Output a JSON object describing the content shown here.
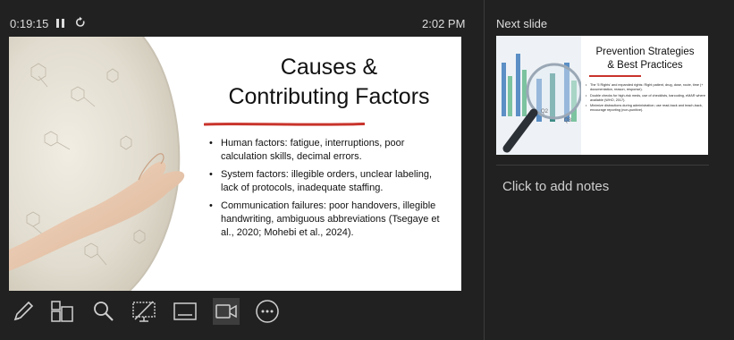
{
  "presenter": {
    "timer": "0:19:15",
    "clock": "2:02 PM"
  },
  "current_slide": {
    "title_line1": "Causes &",
    "title_line2": "Contributing Factors",
    "bullets": [
      "Human factors: fatigue, interruptions, poor calculation skills, decimal errors.",
      "System factors: illegible orders, unclear labeling, lack of protocols, inadequate staffing.",
      "Communication failures: poor handovers, illegible handwriting, ambiguous abbreviations (Tsegaye et al., 2020; Mohebi et al., 2024)."
    ]
  },
  "next_slide": {
    "label": "Next slide",
    "title_line1": "Prevention Strategies",
    "title_line2": "& Best Practices",
    "bullets": [
      "The '5 Rights' and expanded rights: Right patient, drug, dose, route, time (+ documentation, reason, response).",
      "Double checks for high-risk meds, use of checklists, barcoding, eMAR where available (WHO, 2017).",
      "Minimize distractions during administration; use read-back and teach-back, encourage reporting (non-punitive)."
    ]
  },
  "notes": {
    "placeholder": "Click to add notes"
  },
  "toolbar": {
    "icons": [
      "pen-tool-icon",
      "slide-sorter-icon",
      "zoom-icon",
      "black-screen-icon",
      "subtitles-icon",
      "camera-icon",
      "more-options-icon"
    ]
  },
  "colors": {
    "background": "#212121",
    "accent_red": "#c8332b"
  }
}
